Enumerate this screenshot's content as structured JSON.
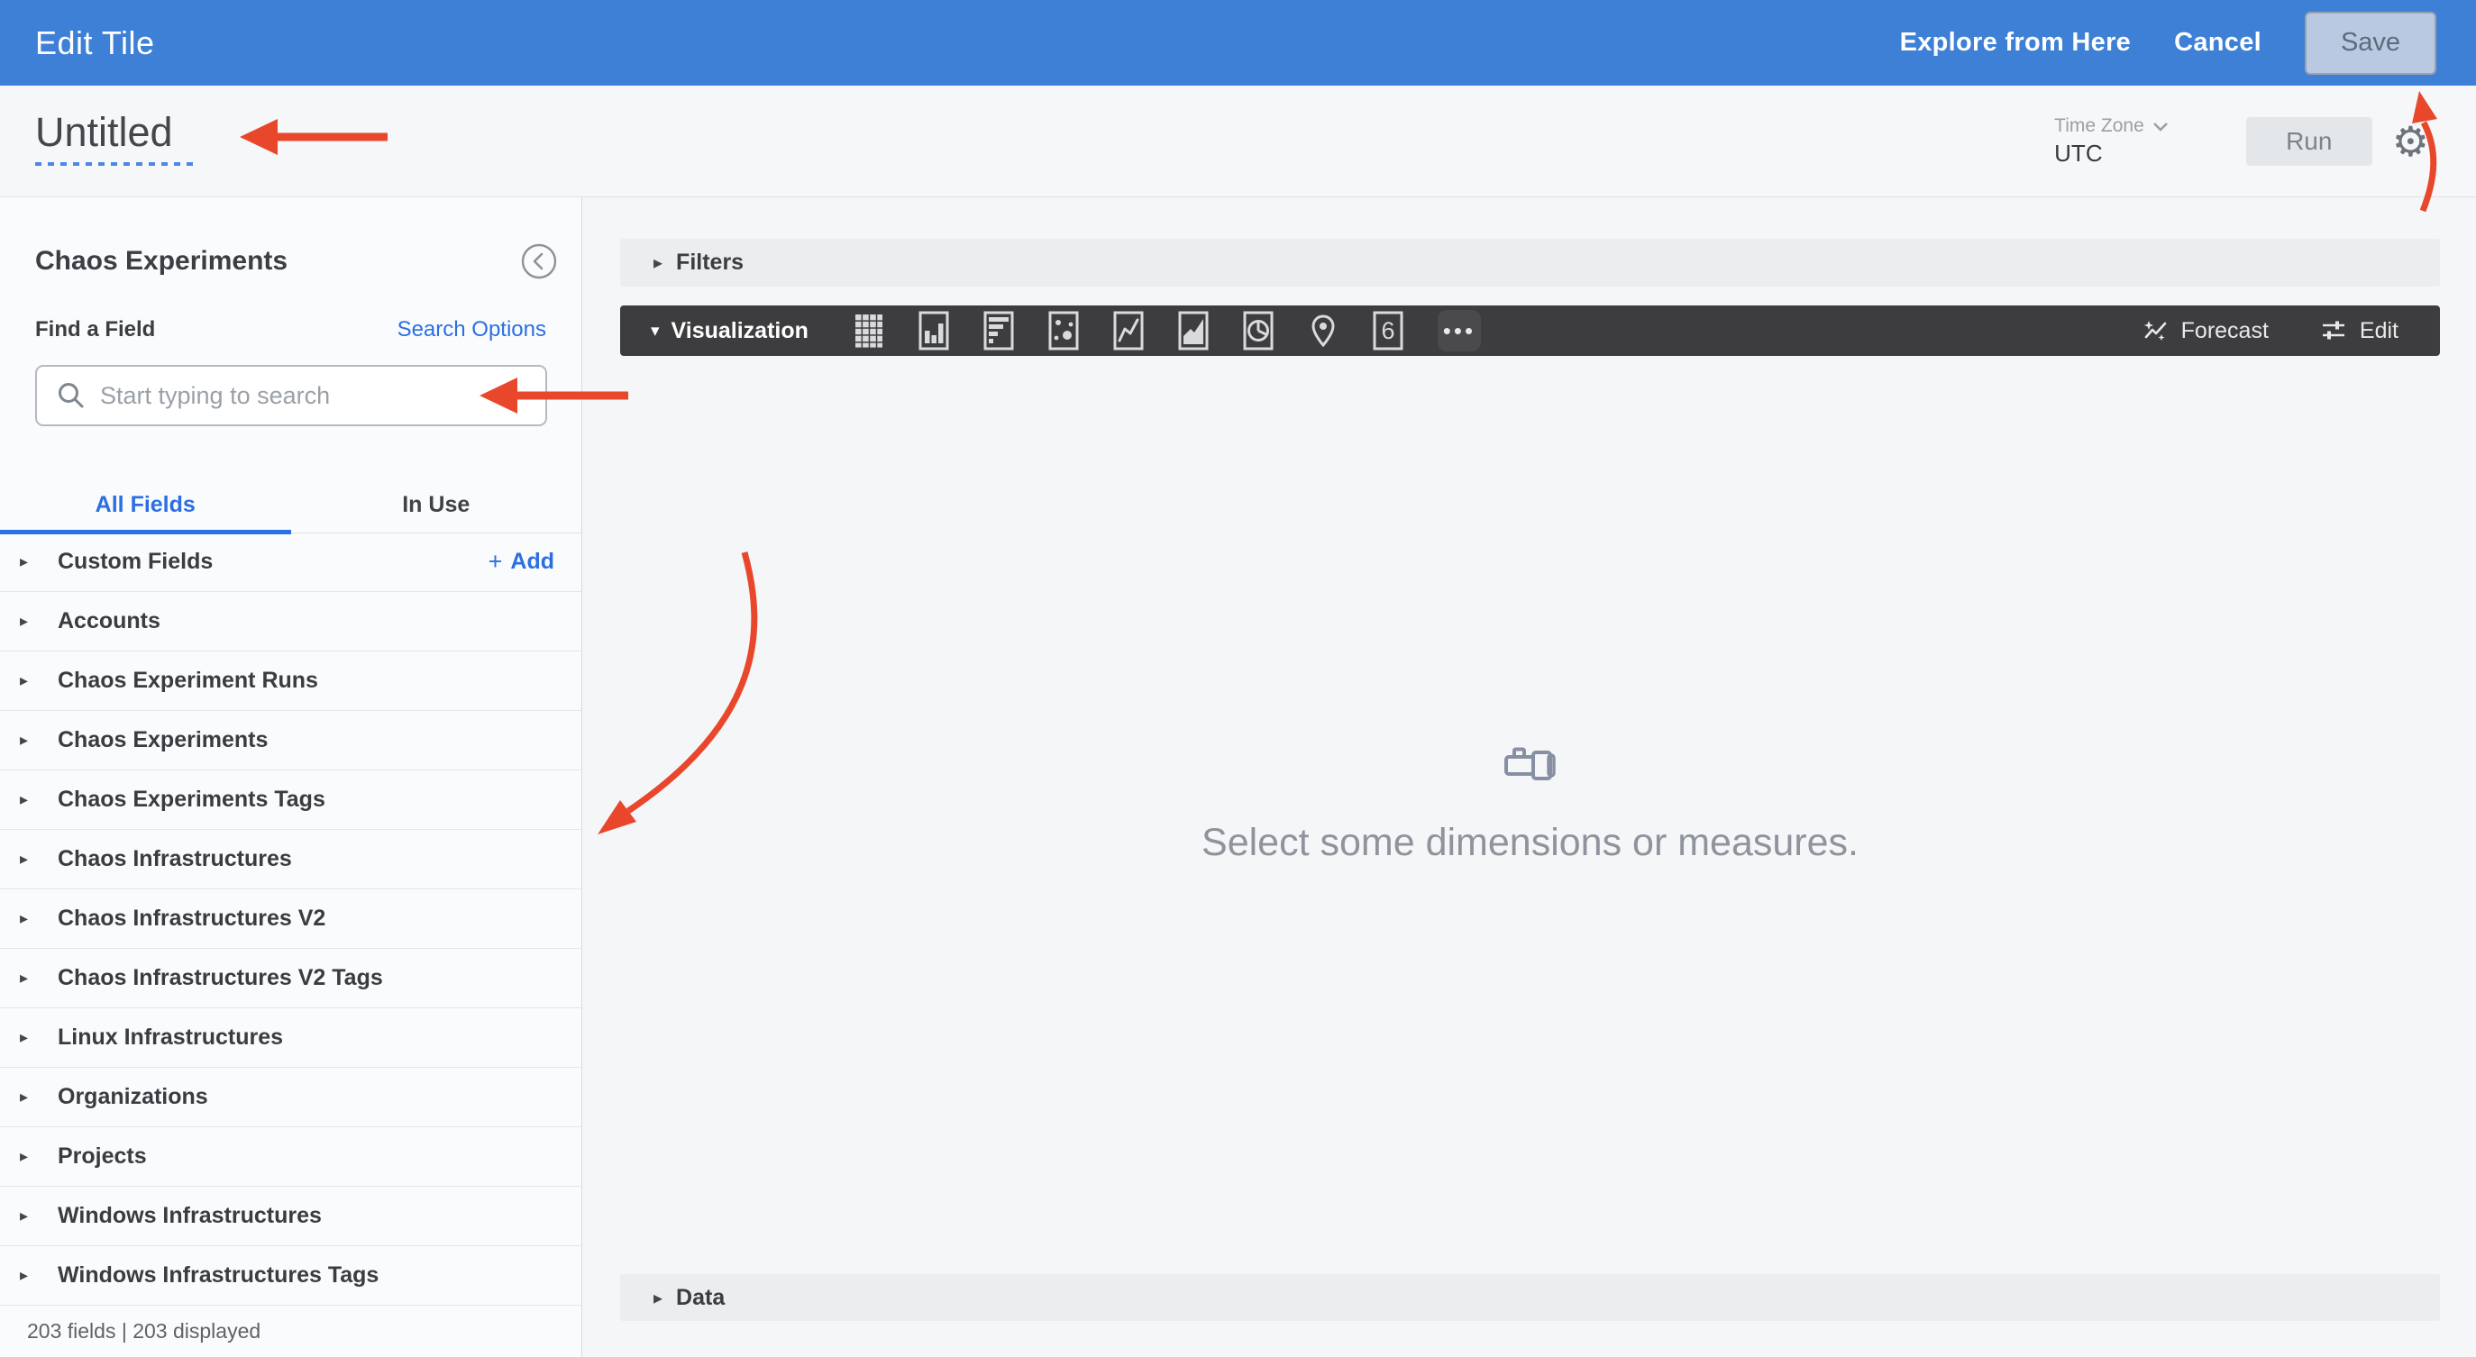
{
  "colors": {
    "top_bar_blue": "#3e80d5",
    "link_blue": "#2b6fe3",
    "annotation_red": "#e8472b",
    "viz_bar_dark": "#3d3d3f",
    "save_button_bg": "#b9c9e1"
  },
  "icons": {
    "caret_right": "▸",
    "caret_down": "▾",
    "gear": "⚙",
    "ellipsis_dots": "•••"
  },
  "top_bar": {
    "title": "Edit Tile",
    "explore_label": "Explore from Here",
    "cancel_label": "Cancel",
    "save_label": "Save"
  },
  "header": {
    "tile_title": "Untitled",
    "time_zone_label": "Time Zone",
    "time_zone_value": "UTC",
    "run_label": "Run"
  },
  "sidebar": {
    "title": "Chaos Experiments",
    "find_field_label": "Find a Field",
    "search_options_label": "Search Options",
    "search_placeholder": "Start typing to search",
    "tabs": [
      {
        "label": "All Fields"
      },
      {
        "label": "In Use"
      }
    ],
    "add_plus": "+",
    "add_label": "Add",
    "items": [
      "Custom Fields",
      "Accounts",
      "Chaos Experiment Runs",
      "Chaos Experiments",
      "Chaos Experiments Tags",
      "Chaos Infrastructures",
      "Chaos Infrastructures V2",
      "Chaos Infrastructures V2 Tags",
      "Linux Infrastructures",
      "Organizations",
      "Projects",
      "Windows Infrastructures",
      "Windows Infrastructures Tags"
    ],
    "footer": "203 fields | 203 displayed"
  },
  "main": {
    "filters_label": "Filters",
    "visualization_label": "Visualization",
    "viz_icon_names": [
      "table",
      "column-chart",
      "bar-chart",
      "scatterplot",
      "line-chart",
      "area-chart",
      "pie-chart",
      "map",
      "single-value",
      "more-options"
    ],
    "single_value_glyph": "6",
    "forecast_label": "Forecast",
    "edit_label": "Edit",
    "empty_state_message": "Select some dimensions or measures.",
    "data_label": "Data"
  }
}
